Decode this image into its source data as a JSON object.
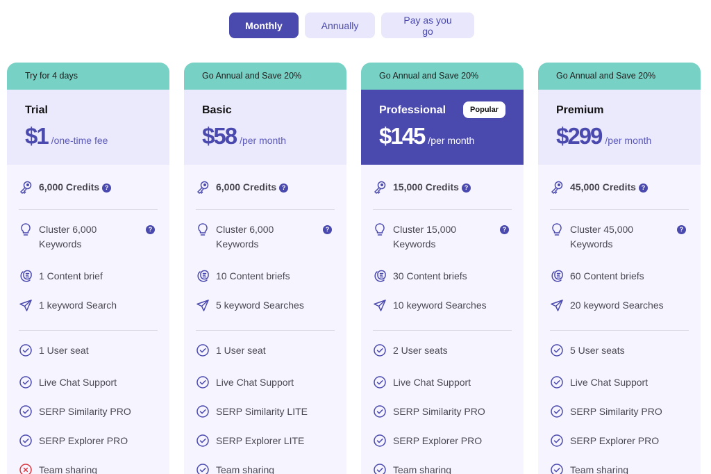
{
  "billing_toggle": [
    {
      "label": "Monthly",
      "active": true
    },
    {
      "label": "Annually",
      "active": false
    },
    {
      "label": "Pay as you go",
      "active": false
    }
  ],
  "colors": {
    "accent": "#4a49ad",
    "banner": "#77d1c4",
    "card_bg": "#f6f5ff",
    "header_bg": "#ebe9fc",
    "check": "#4a49ad",
    "cross": "#d9363e"
  },
  "plans": [
    {
      "banner": "Try for 4 days",
      "name": "Trial",
      "price": "$1",
      "period": "/one-time fee",
      "featured": false,
      "credits": "6,000 Credits",
      "cluster": "Cluster 6,000 Keywords",
      "briefs": "1 Content brief",
      "searches": "1 keyword Search",
      "features": [
        {
          "label": "1 User seat",
          "included": true
        },
        {
          "label": "Live Chat Support",
          "included": true
        },
        {
          "label": "SERP Similarity PRO",
          "included": true
        },
        {
          "label": "SERP Explorer PRO",
          "included": true
        },
        {
          "label": "Team sharing",
          "included": false
        }
      ]
    },
    {
      "banner": "Go Annual and Save 20%",
      "name": "Basic",
      "price": "$58",
      "period": "/per month",
      "featured": false,
      "credits": "6,000 Credits",
      "cluster": "Cluster 6,000 Keywords",
      "briefs": "10 Content briefs",
      "searches": "5 keyword Searches",
      "features": [
        {
          "label": "1 User seat",
          "included": true
        },
        {
          "label": "Live Chat Support",
          "included": true
        },
        {
          "label": "SERP Similarity LITE",
          "included": true
        },
        {
          "label": "SERP Explorer LITE",
          "included": true
        },
        {
          "label": "Team sharing",
          "included": true
        }
      ]
    },
    {
      "banner": "Go Annual and Save 20%",
      "name": "Professional",
      "price": "$145",
      "period": "/per month",
      "featured": true,
      "badge": "Popular",
      "credits": "15,000 Credits",
      "cluster": "Cluster 15,000 Keywords",
      "briefs": "30 Content briefs",
      "searches": "10 keyword Searches",
      "features": [
        {
          "label": "2 User seats",
          "included": true
        },
        {
          "label": "Live Chat Support",
          "included": true
        },
        {
          "label": "SERP Similarity PRO",
          "included": true
        },
        {
          "label": "SERP Explorer PRO",
          "included": true
        },
        {
          "label": "Team sharing",
          "included": true
        }
      ]
    },
    {
      "banner": "Go Annual and Save 20%",
      "name": "Premium",
      "price": "$299",
      "period": "/per month",
      "featured": false,
      "credits": "45,000 Credits",
      "cluster": "Cluster 45,000 Keywords",
      "briefs": "60 Content briefs",
      "searches": "20 keyword Searches",
      "features": [
        {
          "label": "5 User seats",
          "included": true
        },
        {
          "label": "Live Chat Support",
          "included": true
        },
        {
          "label": "SERP Similarity PRO",
          "included": true
        },
        {
          "label": "SERP Explorer PRO",
          "included": true
        },
        {
          "label": "Team sharing",
          "included": true
        }
      ]
    }
  ],
  "help_glyph": "?"
}
